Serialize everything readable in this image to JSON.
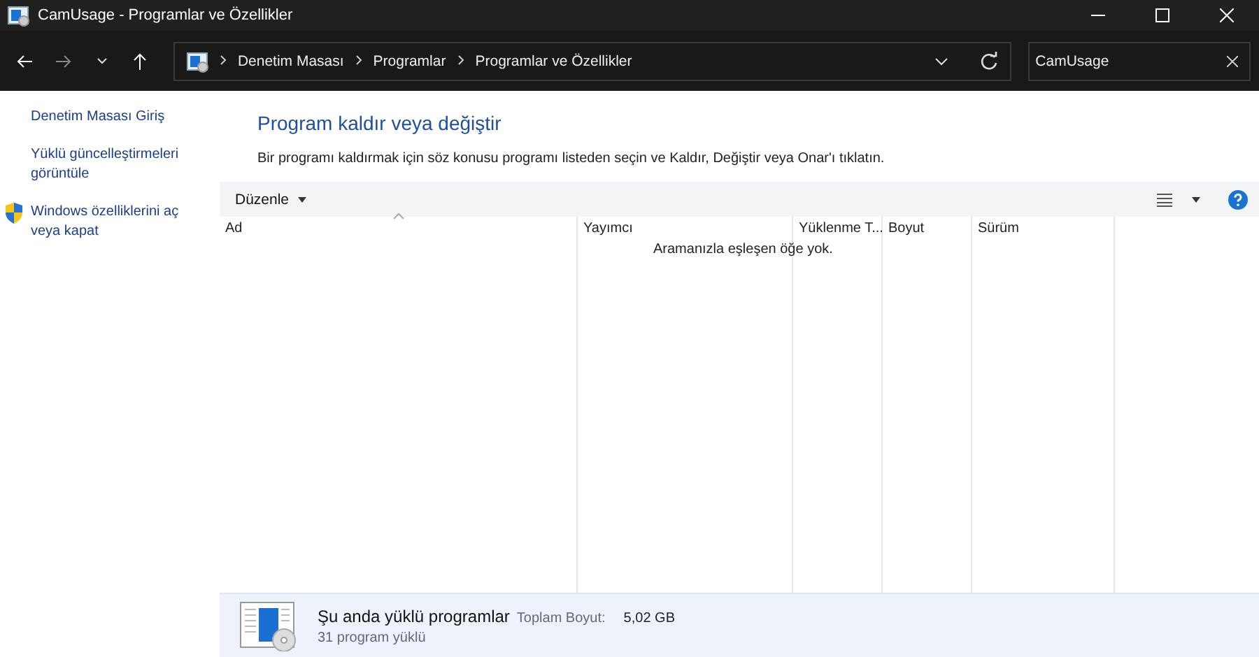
{
  "window": {
    "title": "CamUsage - Programlar ve Özellikler"
  },
  "address_bar": {
    "crumbs": [
      "Denetim Masası",
      "Programlar",
      "Programlar ve Özellikler"
    ]
  },
  "search": {
    "value": "CamUsage"
  },
  "sidebar": {
    "items": [
      {
        "label": "Denetim Masası Giriş",
        "kind": "link"
      },
      {
        "label": "Yüklü güncelleştirmeleri görüntüle",
        "kind": "link"
      },
      {
        "label": "Windows özelliklerini aç veya kapat",
        "kind": "shield"
      }
    ]
  },
  "heading": "Program kaldır veya değiştir",
  "description": "Bir programı kaldırmak için söz konusu programı listeden seçin ve Kaldır, Değiştir veya Onar'ı tıklatın.",
  "toolbar": {
    "organize": "Düzenle"
  },
  "table": {
    "columns": [
      "Ad",
      "Yayımcı",
      "Yüklenme T...",
      "Boyut",
      "Sürüm"
    ],
    "empty_message": "Aramanızla eşleşen öğe yok."
  },
  "status_bar": {
    "title": "Şu anda yüklü programlar",
    "size_label": "Toplam Boyut:",
    "size_value": "5,02 GB",
    "count": "31 program yüklü"
  }
}
